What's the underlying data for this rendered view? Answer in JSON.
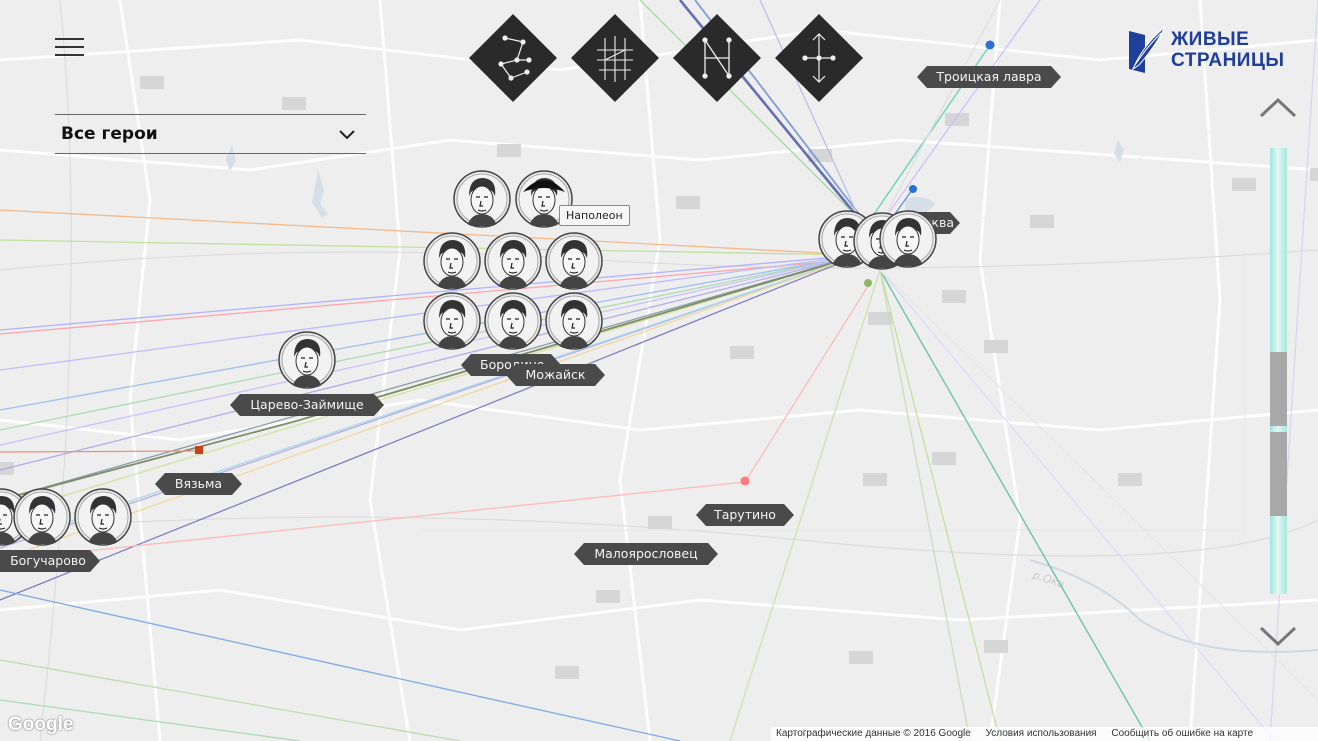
{
  "menu": {
    "icon": "hamburger-menu-icon"
  },
  "hero_filter": {
    "selected": "Все герои",
    "icon": "chevron-down-icon"
  },
  "view_modes": [
    {
      "name": "constellation-mode-icon"
    },
    {
      "name": "grid-mode-icon"
    },
    {
      "name": "letter-mode-icon"
    },
    {
      "name": "tree-mode-icon"
    }
  ],
  "logo": {
    "line1": "ЖИВЫЕ",
    "line2": "СТРАНИЦЫ",
    "icon": "quill-book-icon",
    "color": "#1f3f9a"
  },
  "places": [
    {
      "id": "troitskaya",
      "label": "Троицкая лавра"
    },
    {
      "id": "moscow",
      "label": "Москва"
    },
    {
      "id": "borodino",
      "label": "Бородино"
    },
    {
      "id": "mozhaisk",
      "label": "Можайск"
    },
    {
      "id": "tsarevo",
      "label": "Царево-Займище"
    },
    {
      "id": "vyazma",
      "label": "Вязьма"
    },
    {
      "id": "tarutino",
      "label": "Тарутино"
    },
    {
      "id": "maloyaroslavets",
      "label": "Малоярословец"
    },
    {
      "id": "bogucharovo",
      "label": "Богучарово"
    }
  ],
  "tooltip": {
    "text": "Наполеон"
  },
  "timeline": {
    "up_icon": "chevron-up-icon",
    "down_icon": "chevron-down-icon"
  },
  "map_water_label": "р.Ока",
  "attribution": {
    "google": "Google",
    "map_data": "Картографические данные © 2016 Google",
    "terms": "Условия использования",
    "report": "Сообщить об ошибке на карте"
  },
  "colors": {
    "label_bg": "#4a4a4a",
    "accent_blue": "#1f3f9a",
    "timeline_fill": "#a6e7de"
  }
}
